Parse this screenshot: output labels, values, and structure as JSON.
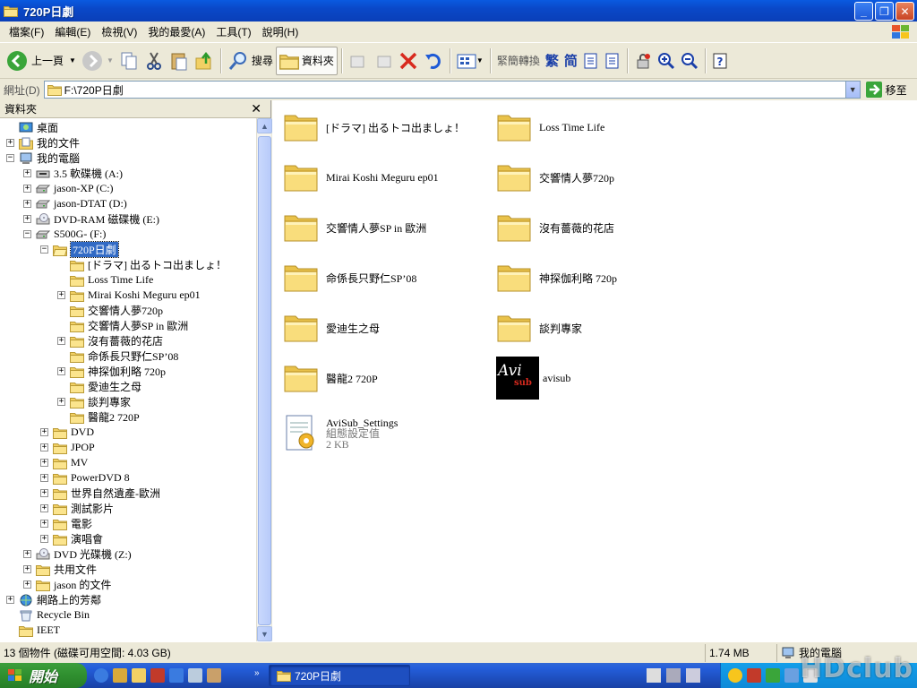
{
  "window": {
    "title": "720P日劇"
  },
  "menu": [
    "檔案(F)",
    "編輯(E)",
    "檢視(V)",
    "我的最愛(A)",
    "工具(T)",
    "說明(H)"
  ],
  "toolbar": {
    "back": "上一頁",
    "search": "搜尋",
    "folders": "資料夾",
    "convert": "緊簡轉換",
    "trad": "繁",
    "simp": "简"
  },
  "address": {
    "label": "網址(D)",
    "value": "F:\\720P日劇",
    "go": "移至"
  },
  "panel": {
    "title": "資料夾"
  },
  "tree": [
    {
      "label": "桌面"
    },
    {
      "label": "我的文件"
    },
    {
      "label": "我的電腦"
    },
    {
      "label": "3.5 軟碟機 (A:)"
    },
    {
      "label": "jason-XP (C:)"
    },
    {
      "label": "jason-DTAT (D:)"
    },
    {
      "label": "DVD-RAM 磁碟機 (E:)"
    },
    {
      "label": "S500G- (F:)"
    },
    {
      "label": "720P日劇"
    },
    {
      "label": "[ドラマ] 出るトコ出ましょ！"
    },
    {
      "label": "Loss Time Life"
    },
    {
      "label": "Mirai Koshi Meguru ep01"
    },
    {
      "label": "交響情人夢720p"
    },
    {
      "label": "交響情人夢SP in 歐洲"
    },
    {
      "label": "沒有薔薇的花店"
    },
    {
      "label": "命係長只野仁SP’08"
    },
    {
      "label": "神探伽利略 720p"
    },
    {
      "label": "愛迪生之母"
    },
    {
      "label": "談判專家"
    },
    {
      "label": "醫龍2 720P"
    },
    {
      "label": "DVD"
    },
    {
      "label": "JPOP"
    },
    {
      "label": "MV"
    },
    {
      "label": "PowerDVD 8"
    },
    {
      "label": "世界自然遺產-歐洲"
    },
    {
      "label": "測試影片"
    },
    {
      "label": "電影"
    },
    {
      "label": "演唱會"
    },
    {
      "label": "DVD 光碟機 (Z:)"
    },
    {
      "label": "共用文件"
    },
    {
      "label": "jason 的文件"
    },
    {
      "label": "網路上的芳鄰"
    },
    {
      "label": "Recycle Bin"
    },
    {
      "label": "IEET"
    }
  ],
  "files": [
    {
      "name": "[ドラマ] 出るトコ出ましょ！",
      "type": "folder"
    },
    {
      "name": "Loss Time Life",
      "type": "folder"
    },
    {
      "name": "Mirai Koshi Meguru ep01",
      "type": "folder"
    },
    {
      "name": "交響情人夢720p",
      "type": "folder"
    },
    {
      "name": "交響情人夢SP in 歐洲",
      "type": "folder"
    },
    {
      "name": "沒有薔薇的花店",
      "type": "folder"
    },
    {
      "name": "命係長只野仁SP’08",
      "type": "folder"
    },
    {
      "name": "神探伽利略 720p",
      "type": "folder"
    },
    {
      "name": "愛迪生之母",
      "type": "folder"
    },
    {
      "name": "談判專家",
      "type": "folder"
    },
    {
      "name": "醫龍2 720P",
      "type": "folder"
    },
    {
      "name": "avisub",
      "type": "app",
      "icon_text": "Avi",
      "icon_sub": "sub"
    },
    {
      "name": "AviSub_Settings",
      "type": "settings",
      "desc": "組態設定值",
      "size": "2 KB"
    }
  ],
  "status": {
    "items": "13 個物件 (磁碟可用空間: 4.03 GB)",
    "size": "1.74 MB",
    "location": "我的電腦"
  },
  "taskbar": {
    "start": "開始",
    "task": "720P日劇"
  },
  "watermark": "HDclub",
  "colors": {
    "titlebar": "#0a48c8",
    "folder": "#f5d36a",
    "selection": "#316ac5",
    "start": "#2f8f2f"
  }
}
